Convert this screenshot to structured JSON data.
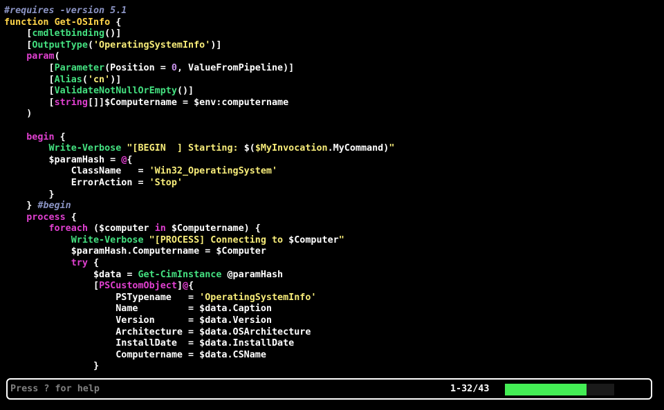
{
  "editor": {
    "lines": [
      [
        {
          "t": "#requires -version 5.1",
          "c": "comment"
        }
      ],
      [
        {
          "t": "function ",
          "c": "keyword"
        },
        {
          "t": "Get-OSInfo",
          "c": "function"
        },
        {
          "t": " {",
          "c": "plain"
        }
      ],
      [
        {
          "t": "    [",
          "c": "plain"
        },
        {
          "t": "cmdletbinding",
          "c": "attr"
        },
        {
          "t": "()]",
          "c": "plain"
        }
      ],
      [
        {
          "t": "    [",
          "c": "plain"
        },
        {
          "t": "OutputType",
          "c": "attr"
        },
        {
          "t": "(",
          "c": "plain"
        },
        {
          "t": "'OperatingSystemInfo'",
          "c": "string"
        },
        {
          "t": ")]",
          "c": "plain"
        }
      ],
      [
        {
          "t": "    ",
          "c": "plain"
        },
        {
          "t": "param",
          "c": "type"
        },
        {
          "t": "(",
          "c": "plain"
        }
      ],
      [
        {
          "t": "        [",
          "c": "plain"
        },
        {
          "t": "Parameter",
          "c": "attr"
        },
        {
          "t": "(Position = ",
          "c": "plain"
        },
        {
          "t": "0",
          "c": "number"
        },
        {
          "t": ", ValueFromPipeline)]",
          "c": "plain"
        }
      ],
      [
        {
          "t": "        [",
          "c": "plain"
        },
        {
          "t": "Alias",
          "c": "attr"
        },
        {
          "t": "(",
          "c": "plain"
        },
        {
          "t": "'cn'",
          "c": "string"
        },
        {
          "t": ")]",
          "c": "plain"
        }
      ],
      [
        {
          "t": "        [",
          "c": "plain"
        },
        {
          "t": "ValidateNotNullOrEmpty",
          "c": "attr"
        },
        {
          "t": "()]",
          "c": "plain"
        }
      ],
      [
        {
          "t": "        [",
          "c": "plain"
        },
        {
          "t": "string",
          "c": "type"
        },
        {
          "t": "[]]$Computername = $env:computername",
          "c": "plain"
        }
      ],
      [
        {
          "t": "    )",
          "c": "plain"
        }
      ],
      [
        {
          "t": "",
          "c": "plain"
        }
      ],
      [
        {
          "t": "    ",
          "c": "plain"
        },
        {
          "t": "begin",
          "c": "type"
        },
        {
          "t": " {",
          "c": "plain"
        }
      ],
      [
        {
          "t": "        ",
          "c": "plain"
        },
        {
          "t": "Write-Verbose",
          "c": "cmdlet"
        },
        {
          "t": " ",
          "c": "plain"
        },
        {
          "t": "\"[BEGIN  ] Starting: ",
          "c": "string"
        },
        {
          "t": "$(",
          "c": "plain"
        },
        {
          "t": "$MyInvocation",
          "c": "string"
        },
        {
          "t": ".MyCommand)",
          "c": "plain"
        },
        {
          "t": "\"",
          "c": "string"
        }
      ],
      [
        {
          "t": "        $paramHash = ",
          "c": "plain"
        },
        {
          "t": "@",
          "c": "type"
        },
        {
          "t": "{",
          "c": "plain"
        }
      ],
      [
        {
          "t": "            ClassName   = ",
          "c": "plain"
        },
        {
          "t": "'Win32_OperatingSystem'",
          "c": "string"
        }
      ],
      [
        {
          "t": "            ErrorAction = ",
          "c": "plain"
        },
        {
          "t": "'Stop'",
          "c": "string"
        }
      ],
      [
        {
          "t": "        }",
          "c": "plain"
        }
      ],
      [
        {
          "t": "    } ",
          "c": "plain"
        },
        {
          "t": "#begin",
          "c": "comment"
        }
      ],
      [
        {
          "t": "    ",
          "c": "plain"
        },
        {
          "t": "process",
          "c": "type"
        },
        {
          "t": " {",
          "c": "plain"
        }
      ],
      [
        {
          "t": "        ",
          "c": "plain"
        },
        {
          "t": "foreach",
          "c": "type"
        },
        {
          "t": " ($computer ",
          "c": "plain"
        },
        {
          "t": "in",
          "c": "type"
        },
        {
          "t": " $Computername) {",
          "c": "plain"
        }
      ],
      [
        {
          "t": "            ",
          "c": "plain"
        },
        {
          "t": "Write-Verbose",
          "c": "cmdlet"
        },
        {
          "t": " ",
          "c": "plain"
        },
        {
          "t": "\"[PROCESS] Connecting to ",
          "c": "string"
        },
        {
          "t": "$Computer",
          "c": "plain"
        },
        {
          "t": "\"",
          "c": "string"
        }
      ],
      [
        {
          "t": "            $paramHash.Computername = $Computer",
          "c": "plain"
        }
      ],
      [
        {
          "t": "            ",
          "c": "plain"
        },
        {
          "t": "try",
          "c": "type"
        },
        {
          "t": " {",
          "c": "plain"
        }
      ],
      [
        {
          "t": "                $data = ",
          "c": "plain"
        },
        {
          "t": "Get-CimInstance",
          "c": "cmdlet"
        },
        {
          "t": " @paramHash",
          "c": "plain"
        }
      ],
      [
        {
          "t": "                [",
          "c": "plain"
        },
        {
          "t": "PSCustomObject",
          "c": "type"
        },
        {
          "t": "]",
          "c": "plain"
        },
        {
          "t": "@",
          "c": "type"
        },
        {
          "t": "{",
          "c": "plain"
        }
      ],
      [
        {
          "t": "                    PSTypename   = ",
          "c": "plain"
        },
        {
          "t": "'OperatingSystemInfo'",
          "c": "string"
        }
      ],
      [
        {
          "t": "                    Name         = $data.Caption",
          "c": "plain"
        }
      ],
      [
        {
          "t": "                    Version      = $data.Version",
          "c": "plain"
        }
      ],
      [
        {
          "t": "                    Architecture = $data.OSArchitecture",
          "c": "plain"
        }
      ],
      [
        {
          "t": "                    InstallDate  = $data.InstallDate",
          "c": "plain"
        }
      ],
      [
        {
          "t": "                    Computername = $data.CSName",
          "c": "plain"
        }
      ],
      [
        {
          "t": "                }",
          "c": "plain"
        }
      ]
    ]
  },
  "status_bar": {
    "help_text": "Press ? for help",
    "position": "1-32/43",
    "progress_fraction": 0.744
  },
  "colors": {
    "background": "#000000",
    "keyword": "#ffd54a",
    "comment": "#8b94c4",
    "type": "#e040d0",
    "attr": "#44e080",
    "string": "#f7ec79",
    "number": "#c792ea",
    "progress": "#44ee55"
  }
}
